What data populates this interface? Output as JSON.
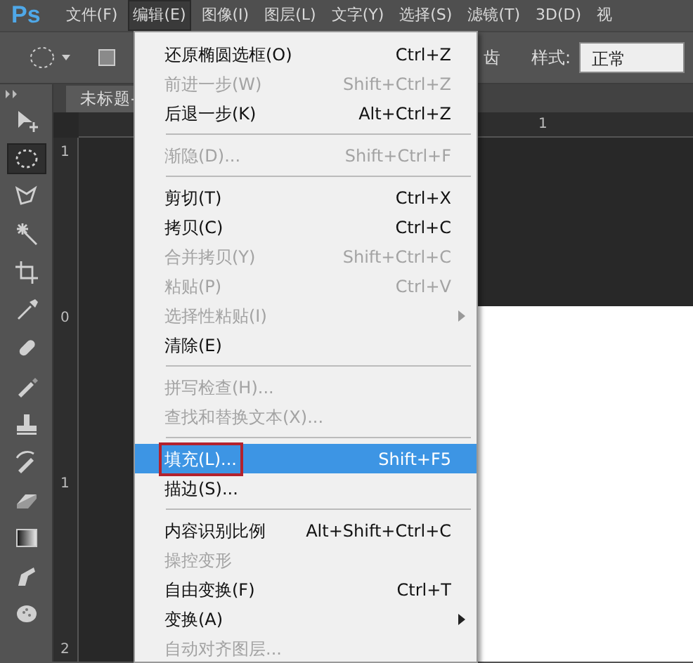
{
  "app_logo": "Ps",
  "menu_bar": [
    {
      "label": "文件(F)",
      "selected": false
    },
    {
      "label": "编辑(E)",
      "selected": true
    },
    {
      "label": "图像(I)",
      "selected": false
    },
    {
      "label": "图层(L)",
      "selected": false
    },
    {
      "label": "文字(Y)",
      "selected": false
    },
    {
      "label": "选择(S)",
      "selected": false
    },
    {
      "label": "滤镜(T)",
      "selected": false
    },
    {
      "label": "3D(D)",
      "selected": false
    },
    {
      "label": "视",
      "selected": false
    }
  ],
  "options_bar": {
    "partial_label": "齿",
    "style_label": "样式:",
    "style_value": "正常"
  },
  "document_tab": "未标题-",
  "rulers": {
    "horizontal": [
      "1"
    ],
    "vertical": [
      "1",
      "0",
      "1",
      "2"
    ]
  },
  "tools": [
    {
      "selected": false
    },
    {
      "selected": true
    },
    {
      "selected": false
    },
    {
      "selected": false
    },
    {
      "selected": false
    },
    {
      "selected": false
    },
    {
      "selected": false
    },
    {
      "selected": false
    },
    {
      "selected": false
    },
    {
      "selected": false
    },
    {
      "selected": false
    },
    {
      "selected": false
    },
    {
      "selected": false
    },
    {
      "selected": false
    }
  ],
  "edit_menu": [
    {
      "kind": "item",
      "label": "还原椭圆选框(O)",
      "shortcut": "Ctrl+Z",
      "disabled": false,
      "selected": false,
      "submenu": false,
      "outlined": false
    },
    {
      "kind": "item",
      "label": "前进一步(W)",
      "shortcut": "Shift+Ctrl+Z",
      "disabled": true,
      "selected": false,
      "submenu": false,
      "outlined": false
    },
    {
      "kind": "item",
      "label": "后退一步(K)",
      "shortcut": "Alt+Ctrl+Z",
      "disabled": false,
      "selected": false,
      "submenu": false,
      "outlined": false
    },
    {
      "kind": "separator"
    },
    {
      "kind": "item",
      "label": "渐隐(D)...",
      "shortcut": "Shift+Ctrl+F",
      "disabled": true,
      "selected": false,
      "submenu": false,
      "outlined": false
    },
    {
      "kind": "separator"
    },
    {
      "kind": "item",
      "label": "剪切(T)",
      "shortcut": "Ctrl+X",
      "disabled": false,
      "selected": false,
      "submenu": false,
      "outlined": false
    },
    {
      "kind": "item",
      "label": "拷贝(C)",
      "shortcut": "Ctrl+C",
      "disabled": false,
      "selected": false,
      "submenu": false,
      "outlined": false
    },
    {
      "kind": "item",
      "label": "合并拷贝(Y)",
      "shortcut": "Shift+Ctrl+C",
      "disabled": true,
      "selected": false,
      "submenu": false,
      "outlined": false
    },
    {
      "kind": "item",
      "label": "粘贴(P)",
      "shortcut": "Ctrl+V",
      "disabled": true,
      "selected": false,
      "submenu": false,
      "outlined": false
    },
    {
      "kind": "item",
      "label": "选择性粘贴(I)",
      "disabled": true,
      "selected": false,
      "submenu": true,
      "outlined": false
    },
    {
      "kind": "item",
      "label": "清除(E)",
      "disabled": false,
      "selected": false,
      "submenu": false,
      "outlined": false
    },
    {
      "kind": "separator"
    },
    {
      "kind": "item",
      "label": "拼写检查(H)...",
      "disabled": true,
      "selected": false,
      "submenu": false,
      "outlined": false
    },
    {
      "kind": "item",
      "label": "查找和替换文本(X)...",
      "disabled": true,
      "selected": false,
      "submenu": false,
      "outlined": false
    },
    {
      "kind": "separator"
    },
    {
      "kind": "item",
      "label": "填充(L)...",
      "shortcut": "Shift+F5",
      "disabled": false,
      "selected": true,
      "submenu": false,
      "outlined": true
    },
    {
      "kind": "item",
      "label": "描边(S)...",
      "disabled": false,
      "selected": false,
      "submenu": false,
      "outlined": false
    },
    {
      "kind": "separator"
    },
    {
      "kind": "item",
      "label": "内容识别比例",
      "shortcut": "Alt+Shift+Ctrl+C",
      "disabled": false,
      "selected": false,
      "submenu": false,
      "outlined": false
    },
    {
      "kind": "item",
      "label": "操控变形",
      "disabled": true,
      "selected": false,
      "submenu": false,
      "outlined": false
    },
    {
      "kind": "item",
      "label": "自由变换(F)",
      "shortcut": "Ctrl+T",
      "disabled": false,
      "selected": false,
      "submenu": false,
      "outlined": false
    },
    {
      "kind": "item",
      "label": "变换(A)",
      "disabled": false,
      "selected": false,
      "submenu": true,
      "outlined": false
    },
    {
      "kind": "item",
      "label": "自动对齐图层...",
      "disabled": true,
      "selected": false,
      "submenu": false,
      "outlined": false
    }
  ]
}
